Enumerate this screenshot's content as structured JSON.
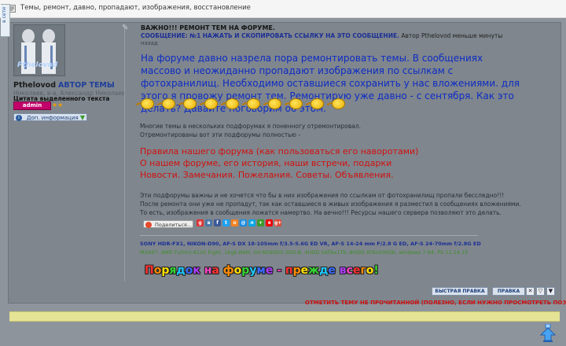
{
  "topbar": {
    "icon": "forum-topic-icon",
    "title": "Темы, ремонт, давно, пропадают, изображения, восстановление"
  },
  "sidebar": {
    "tab_label": "в сети",
    "avatar_text": "Pthelovod",
    "nick": "Pthelovod",
    "role": "АВТОР ТЕМЫ",
    "meta": "Николаев, в-а, Александр Николаев",
    "quote": "Цитата выделенного текста",
    "admin_badge": "admin",
    "info_button": "Доп. информация"
  },
  "post": {
    "title": "ВАЖНО!!! РЕМОНТ ТЕМ НА ФОРУМЕ.",
    "msg_label": "СООБЩЕНИЕ:",
    "msg_num": "№1",
    "copy_link": "НАЖАТЬ И СКОПИРОВАТЬ ССЫЛКУ НА ЭТО СООБЩЕНИЕ.",
    "author_text": "Автор Pthelovod меньше минуты",
    "ago": "назад",
    "blue_text": "На форуме давно назрела пора ремонтировать темы. В сообщениях массово и неожиданно пропадают изображения по ссылкам с фотохранилищ. Необходимо оставшиеся сохранить у нас вложениями. для этого я провожу ремонт тем. Ремонтирую уже давно - с сентября. Как это делать? Давайте поговорим об этом.",
    "gray1_line1": "Многие темы в нескольких подфорумах я поненногу отремонтировал.",
    "gray1_line2": "Отремонтированы вот эти подфорумы полностью -",
    "red_line1": "Правила нашего форума (как пользоваться его наворотами)",
    "red_line2": "О нашем форуме, его история, наши встречи, подарки",
    "red_line3": "Новости. Замечания. Пожелания. Советы. Объявления.",
    "gray2_line1": "Эти подфорумы важны и не хочется что бы в них изображения по ссылкам от фотохранилищ пропали бесследно!!!",
    "gray2_line2": "После ремонта они уже не пропадут, так как оставшиеся в живых изображения я разместил в сообщениях вложениями.",
    "gray2_line3": "То есть, изображения в сообщения ложатся намертво. На вечно!!! Ресурсы нашего сервера позволяют это делать.",
    "share_button": "Поделиться..."
  },
  "signature": {
    "line1": "SONY HDR-FX1, NIKON-D90, AF-S DX 18-105mm f/3.5-5.6G ED VR, AF-S 14-24 mm F/2.8 G ED, AF-S 24-70mm f/2.8G ED",
    "line2": "MSA97, AMD Fx(tm)-8120 Eight, 16gb RAM, GV-N590D3-3GD-B, 4HDD SATAx1Tb, 8HDD ATAx500Gb, windows 7-64, PS 11.14.15",
    "motto": "Порядок на форуме - прежде всего!"
  },
  "actions": {
    "fast_edit": "БЫСТРАЯ ПРАВКА",
    "edit": "ПРАВКА",
    "mark_unread": "ОТМЕТИТЬ ТЕМУ НЕ ПРОЧИТАННОЙ (ПОЛЕЗНО, ЕСЛИ НУЖНО ПРОСМОТРЕТЬ ПОЗЖЕ)"
  },
  "colors": {
    "blue_text": "#0d2bc4",
    "red_text": "#d11010",
    "panel_bg": "#7f868d",
    "yellow_bar": "#e4e396"
  },
  "share_icons": [
    "google",
    "vk",
    "facebook",
    "twitter",
    "odnoklassniki",
    "mailru",
    "livejournal",
    "liveinternet",
    "yandex",
    "googleplus"
  ],
  "smiley_count": 10
}
